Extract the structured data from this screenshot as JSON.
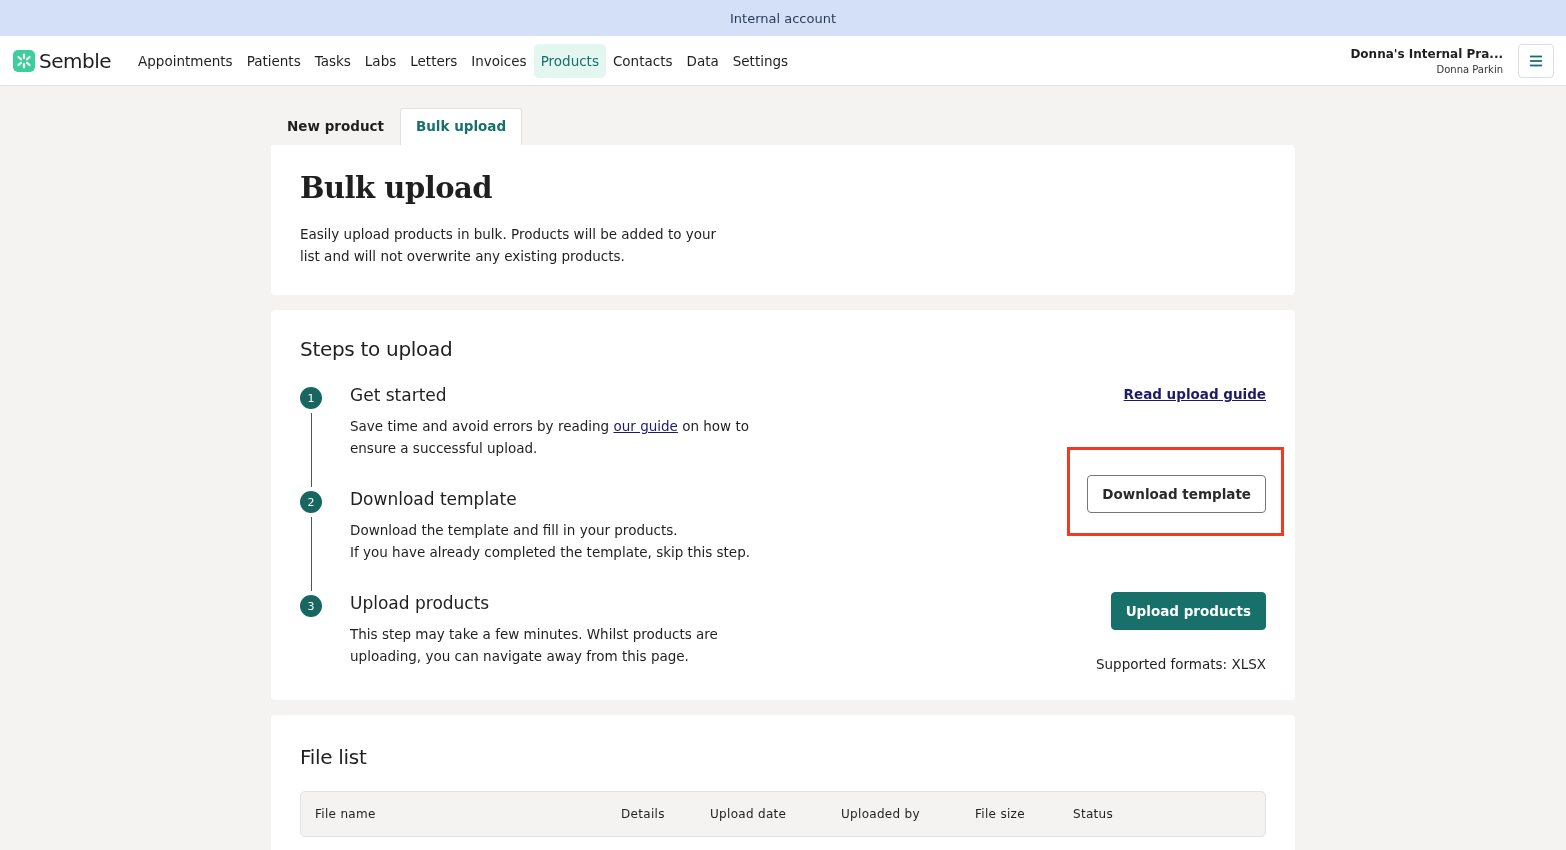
{
  "banner": {
    "text": "Internal account"
  },
  "nav": {
    "brand": "Semble",
    "items": [
      {
        "label": "Appointments",
        "selected": false
      },
      {
        "label": "Patients",
        "selected": false
      },
      {
        "label": "Tasks",
        "selected": false
      },
      {
        "label": "Labs",
        "selected": false
      },
      {
        "label": "Letters",
        "selected": false
      },
      {
        "label": "Invoices",
        "selected": false
      },
      {
        "label": "Products",
        "selected": true
      },
      {
        "label": "Contacts",
        "selected": false
      },
      {
        "label": "Data",
        "selected": false
      },
      {
        "label": "Settings",
        "selected": false
      }
    ],
    "account": "Donna's Internal Pra...",
    "user": "Donna Parkin"
  },
  "tabs": [
    {
      "label": "New product",
      "selected": false
    },
    {
      "label": "Bulk upload",
      "selected": true
    }
  ],
  "intro": {
    "title": "Bulk upload",
    "text": "Easily upload products in bulk. Products will be added to your list and will not overwrite any existing products."
  },
  "steps_card": {
    "title": "Steps to upload",
    "steps": [
      {
        "number": "1",
        "title": "Get started",
        "text_before": "Save time and avoid errors by reading ",
        "link": "our guide",
        "text_after": " on how to ensure a successful upload.",
        "action": {
          "kind": "link",
          "label": "Read upload guide",
          "highlighted": false
        }
      },
      {
        "number": "2",
        "title": "Download template",
        "lines": [
          "Download the template and fill in your products.",
          "If you have already completed the template, skip this step."
        ],
        "action": {
          "kind": "outline",
          "label": "Download template",
          "highlighted": true
        }
      },
      {
        "number": "3",
        "title": "Upload products",
        "lines": [
          "This step may take a few minutes. Whilst products are uploading, you can navigate away from this page."
        ],
        "action": {
          "kind": "primary",
          "label": "Upload products",
          "highlighted": false,
          "note": "Supported formats: XLSX"
        }
      }
    ]
  },
  "file_list": {
    "title": "File list",
    "columns": [
      "File name",
      "Details",
      "Upload date",
      "Uploaded by",
      "File size",
      "Status"
    ]
  }
}
